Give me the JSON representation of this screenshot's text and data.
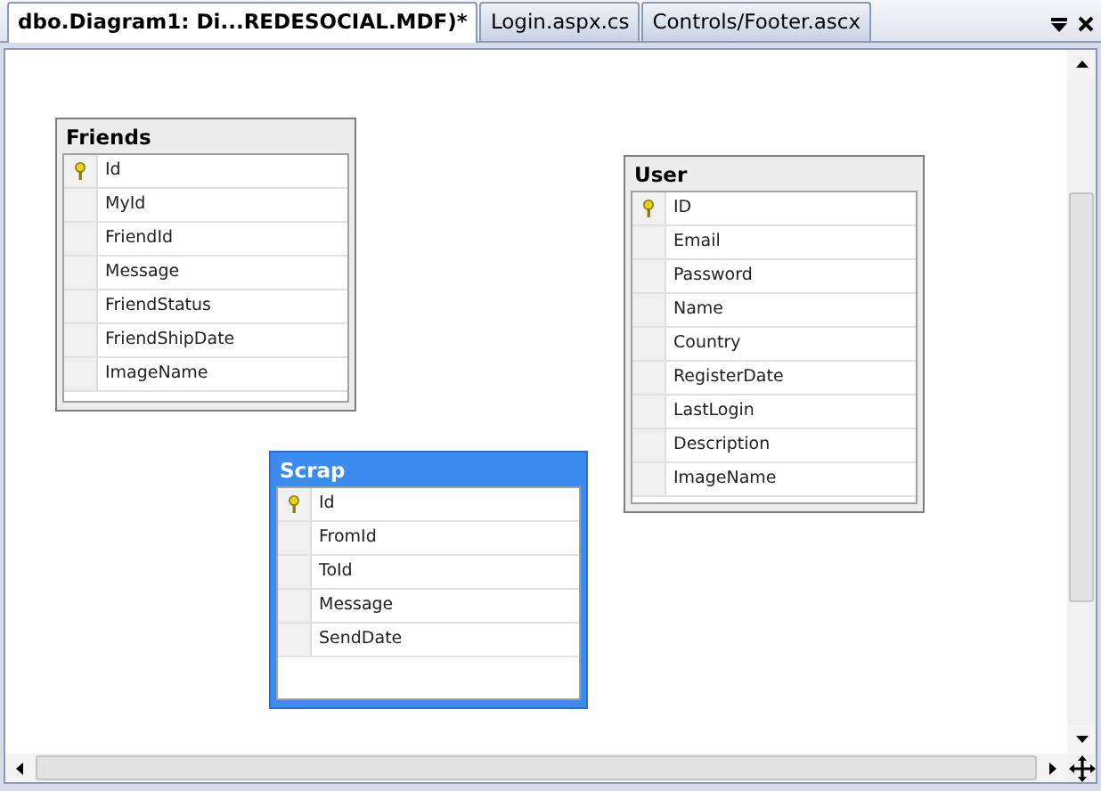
{
  "tabs": [
    {
      "label": "dbo.Diagram1: Di...REDESOCIAL.MDF)*",
      "selected": true
    },
    {
      "label": "Login.aspx.cs",
      "selected": false
    },
    {
      "label": "Controls/Footer.ascx",
      "selected": false
    }
  ],
  "tables": [
    {
      "name": "Friends",
      "selected": false,
      "columns": [
        {
          "name": "Id",
          "key": true
        },
        {
          "name": "MyId",
          "key": false
        },
        {
          "name": "FriendId",
          "key": false
        },
        {
          "name": "Message",
          "key": false
        },
        {
          "name": "FriendStatus",
          "key": false
        },
        {
          "name": "FriendShipDate",
          "key": false
        },
        {
          "name": "ImageName",
          "key": false
        }
      ]
    },
    {
      "name": "User",
      "selected": false,
      "columns": [
        {
          "name": "ID",
          "key": true
        },
        {
          "name": "Email",
          "key": false
        },
        {
          "name": "Password",
          "key": false
        },
        {
          "name": "Name",
          "key": false
        },
        {
          "name": "Country",
          "key": false
        },
        {
          "name": "RegisterDate",
          "key": false
        },
        {
          "name": "LastLogin",
          "key": false
        },
        {
          "name": "Description",
          "key": false
        },
        {
          "name": "ImageName",
          "key": false
        }
      ]
    },
    {
      "name": "Scrap",
      "selected": true,
      "columns": [
        {
          "name": "Id",
          "key": true
        },
        {
          "name": "FromId",
          "key": false
        },
        {
          "name": "ToId",
          "key": false
        },
        {
          "name": "Message",
          "key": false
        },
        {
          "name": "SendDate",
          "key": false
        }
      ]
    }
  ]
}
